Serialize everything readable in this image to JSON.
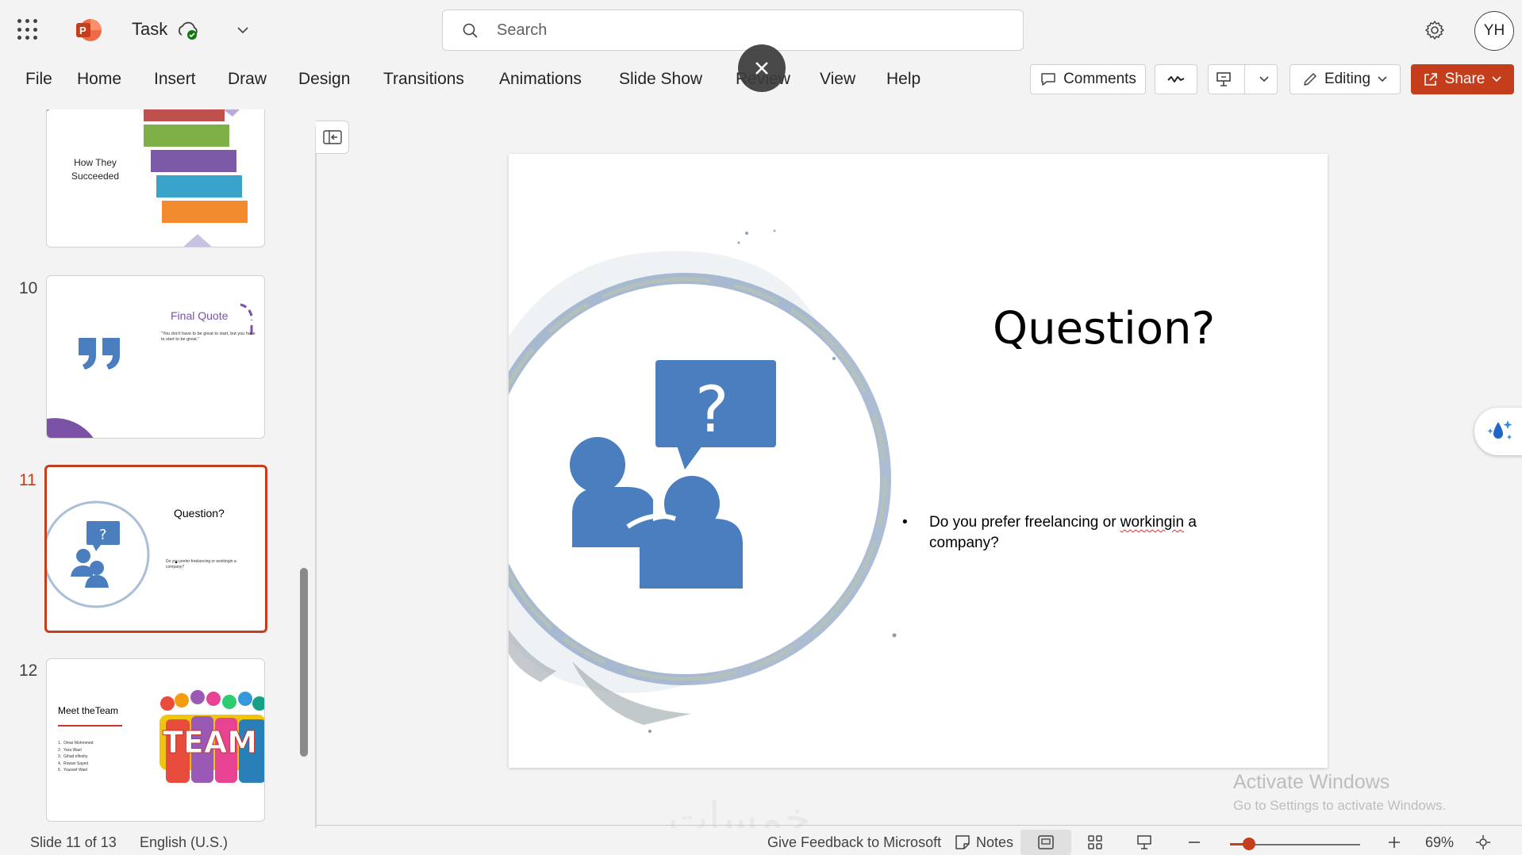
{
  "app": {
    "document_title": "Task",
    "search_placeholder": "Search",
    "avatar_initials": "YH"
  },
  "ribbon": {
    "tabs": [
      "File",
      "Home",
      "Insert",
      "Draw",
      "Design",
      "Transitions",
      "Animations",
      "Slide Show",
      "Review",
      "View",
      "Help"
    ],
    "comments_label": "Comments",
    "editing_label": "Editing",
    "share_label": "Share"
  },
  "thumbnails": {
    "items": [
      {
        "number": "",
        "title": "How They Succeeded"
      },
      {
        "number": "10",
        "title": "Final Quote",
        "quote": "\"You don't have to be great to start, but you have to start to be great.\""
      },
      {
        "number": "11",
        "title": "Question?",
        "bullet": "Do you prefer freelancing or workingin a company?"
      },
      {
        "number": "12",
        "title": "Meet theTeam",
        "list": [
          "Omar Mohmmed",
          "Yara Wael",
          "Gihad elfeshy",
          "Rowan Sayed",
          "Youssef Wael"
        ],
        "art_text": "TEAM"
      }
    ],
    "active_index": 2
  },
  "slide": {
    "title": "Question?",
    "bullet_prefix": "Do you prefer freelancing or ",
    "bullet_misspelled": "workingin",
    "bullet_suffix": " a company?",
    "icon_glyph": "?"
  },
  "watermark": {
    "title": "Activate Windows",
    "subtitle": "Go to Settings to activate Windows.",
    "site_mark": "خمسات"
  },
  "statusbar": {
    "slide_position": "Slide 11 of 13",
    "language": "English (U.S.)",
    "feedback": "Give Feedback to Microsoft",
    "notes": "Notes",
    "zoom": "69%",
    "zoom_level_percent": 69
  },
  "colors": {
    "accent": "#c43e1c",
    "icon_blue": "#4a7ebf",
    "purple": "#7b52a6"
  }
}
